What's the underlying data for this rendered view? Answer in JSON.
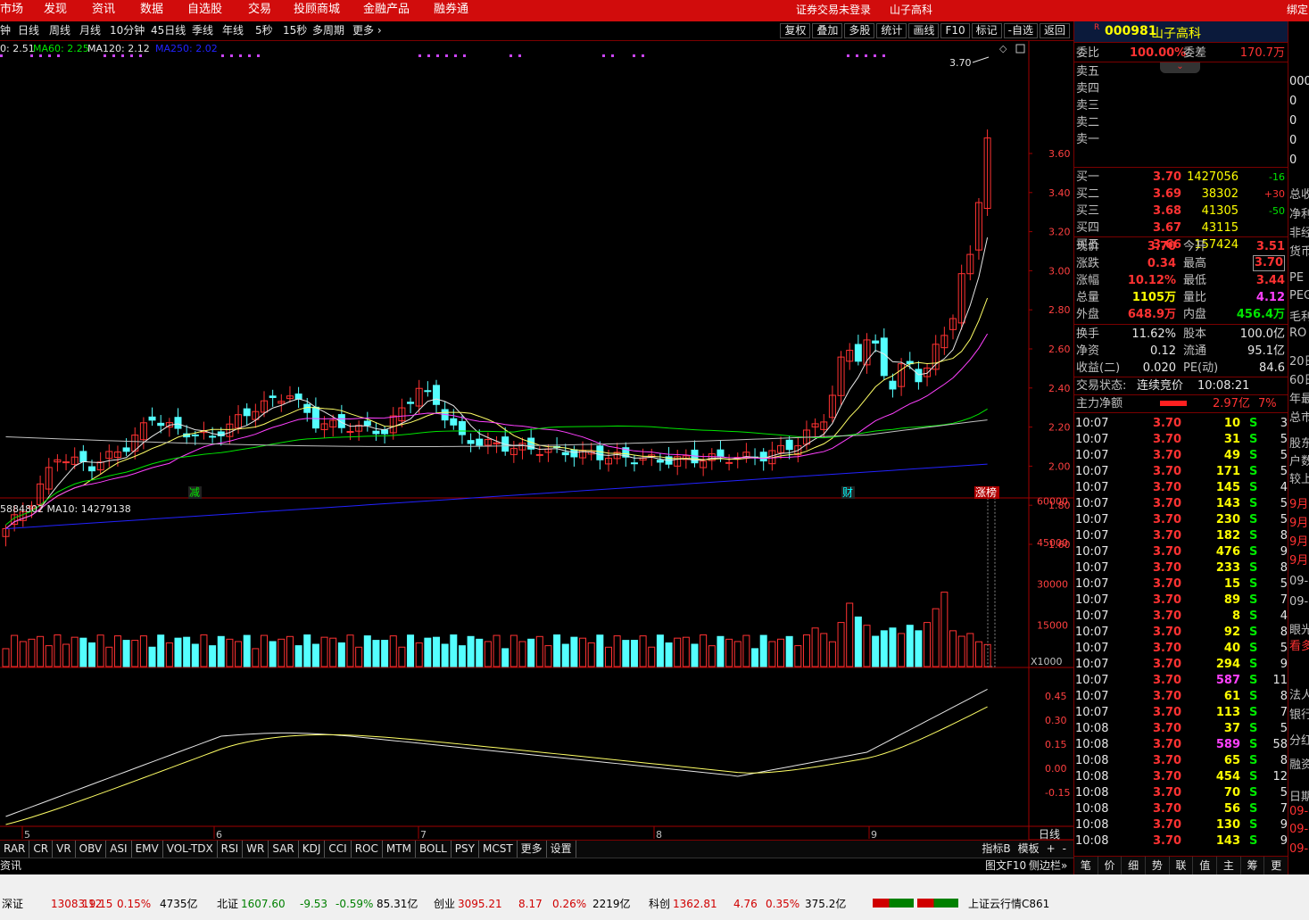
{
  "menu": {
    "items": [
      "市场",
      "发现",
      "资讯",
      "数据",
      "自选股",
      "交易",
      "投顾商城",
      "金融产品",
      "融券通"
    ],
    "right_items": [
      "证券交易未登录",
      "山子高科",
      "绑定"
    ]
  },
  "periods": {
    "items": [
      "钟",
      "日线",
      "周线",
      "月线",
      "10分钟",
      "45日线",
      "季线",
      "年线",
      "5秒",
      "15秒",
      "多周期",
      "更多"
    ],
    "tools": [
      "复权",
      "叠加",
      "多股",
      "统计",
      "画线",
      "F10",
      "标记",
      "-自选",
      "返回"
    ]
  },
  "chart": {
    "ma_legend": [
      {
        "text": "0: 2.51",
        "color": "#e6e6e6"
      },
      {
        "text": "MA60: 2.25",
        "color": "#00e600"
      },
      {
        "text": "MA120: 2.12",
        "color": "#e6e6e6"
      },
      {
        "text": "MA250: 2.02",
        "color": "#2222ff"
      }
    ],
    "price_ticks": [
      "3.60",
      "3.40",
      "3.20",
      "3.00",
      "2.80",
      "2.60",
      "2.40",
      "2.20",
      "2.00",
      "1.80",
      "1.60"
    ],
    "high_label": "3.70",
    "markers": [
      {
        "text": "减",
        "color": "#00e600"
      },
      {
        "text": "财",
        "color": "#00ffff"
      },
      {
        "text": "涨榜",
        "color": "#ffffff"
      }
    ],
    "vol_legend": "5884802 MA10: 14279138",
    "vol_ticks": [
      "60000",
      "45000",
      "30000",
      "15000"
    ],
    "vol_unit": "X1000",
    "macd_ticks": [
      "0.45",
      "0.30",
      "0.15",
      "0.00",
      "-0.15"
    ],
    "month_labels": [
      "5",
      "6",
      "7",
      "8",
      "9"
    ],
    "period_label": "日线"
  },
  "indicators": {
    "tabs": [
      "RAR",
      "CR",
      "VR",
      "OBV",
      "ASI",
      "EMV",
      "VOL-TDX",
      "RSI",
      "WR",
      "SAR",
      "KDJ",
      "CCI",
      "ROC",
      "MTM",
      "BOLL",
      "PSY",
      "MCST",
      "更多",
      "设置"
    ],
    "right": [
      "指标B",
      "模板",
      "+",
      "-"
    ]
  },
  "news": {
    "left": "资讯",
    "right": [
      "图文F10",
      "侧边栏»"
    ]
  },
  "stock": {
    "code": "000981",
    "name": "山子高科",
    "r_mark": "R"
  },
  "quote": {
    "weibi_label": "委比",
    "weibi": "100.00%",
    "weicha_label": "委差",
    "weicha": "170.7万",
    "sells": [
      "卖五",
      "卖四",
      "卖三",
      "卖二",
      "卖一"
    ],
    "buys": [
      {
        "label": "买一",
        "price": "3.70",
        "vol": "1427056",
        "chg": "-16"
      },
      {
        "label": "买二",
        "price": "3.69",
        "vol": "38302",
        "chg": "+30"
      },
      {
        "label": "买三",
        "price": "3.68",
        "vol": "41305",
        "chg": "-50"
      },
      {
        "label": "买四",
        "price": "3.67",
        "vol": "43115",
        "chg": ""
      },
      {
        "label": "买五",
        "price": "3.66",
        "vol": "157424",
        "chg": ""
      }
    ],
    "stats": [
      {
        "l1": "现价",
        "v1": "3.70",
        "c1": "red",
        "l2": "今开",
        "v2": "3.51",
        "c2": "red"
      },
      {
        "l1": "涨跌",
        "v1": "0.34",
        "c1": "red",
        "l2": "最高",
        "v2": "3.70",
        "c2": "red"
      },
      {
        "l1": "涨幅",
        "v1": "10.12%",
        "c1": "red",
        "l2": "最低",
        "v2": "3.44",
        "c2": "red"
      },
      {
        "l1": "总量",
        "v1": "1105万",
        "c1": "yel",
        "l2": "量比",
        "v2": "4.12",
        "c2": "mag"
      },
      {
        "l1": "外盘",
        "v1": "648.9万",
        "c1": "red",
        "l2": "内盘",
        "v2": "456.4万",
        "c2": "grn"
      }
    ],
    "stats2": [
      {
        "l1": "换手",
        "v1": "11.62%",
        "l2": "股本",
        "v2": "100.0亿"
      },
      {
        "l1": "净资",
        "v1": "0.12",
        "l2": "流通",
        "v2": "95.1亿"
      },
      {
        "l1": "收益(二)",
        "v1": "0.020",
        "l2": "PE(动)",
        "v2": "84.6"
      }
    ],
    "trade_status_label": "交易状态:",
    "trade_status": "连续竞价",
    "trade_time": "10:08:21",
    "main_net_label": "主力净额",
    "main_net": "2.97亿",
    "main_pct": "7%"
  },
  "ticks": [
    {
      "t": "10:07",
      "p": "3.70",
      "v": "10",
      "s": "S",
      "n": "3"
    },
    {
      "t": "10:07",
      "p": "3.70",
      "v": "31",
      "s": "S",
      "n": "5"
    },
    {
      "t": "10:07",
      "p": "3.70",
      "v": "49",
      "s": "S",
      "n": "5"
    },
    {
      "t": "10:07",
      "p": "3.70",
      "v": "171",
      "s": "S",
      "n": "5"
    },
    {
      "t": "10:07",
      "p": "3.70",
      "v": "145",
      "s": "S",
      "n": "4"
    },
    {
      "t": "10:07",
      "p": "3.70",
      "v": "143",
      "s": "S",
      "n": "5"
    },
    {
      "t": "10:07",
      "p": "3.70",
      "v": "230",
      "s": "S",
      "n": "5"
    },
    {
      "t": "10:07",
      "p": "3.70",
      "v": "182",
      "s": "S",
      "n": "8"
    },
    {
      "t": "10:07",
      "p": "3.70",
      "v": "476",
      "s": "S",
      "n": "9"
    },
    {
      "t": "10:07",
      "p": "3.70",
      "v": "233",
      "s": "S",
      "n": "8"
    },
    {
      "t": "10:07",
      "p": "3.70",
      "v": "15",
      "s": "S",
      "n": "5"
    },
    {
      "t": "10:07",
      "p": "3.70",
      "v": "89",
      "s": "S",
      "n": "7"
    },
    {
      "t": "10:07",
      "p": "3.70",
      "v": "8",
      "s": "S",
      "n": "4"
    },
    {
      "t": "10:07",
      "p": "3.70",
      "v": "92",
      "s": "S",
      "n": "8"
    },
    {
      "t": "10:07",
      "p": "3.70",
      "v": "40",
      "s": "S",
      "n": "5"
    },
    {
      "t": "10:07",
      "p": "3.70",
      "v": "294",
      "s": "S",
      "n": "9"
    },
    {
      "t": "10:07",
      "p": "3.70",
      "v": "587",
      "s": "S",
      "n": "11"
    },
    {
      "t": "10:07",
      "p": "3.70",
      "v": "61",
      "s": "S",
      "n": "8"
    },
    {
      "t": "10:07",
      "p": "3.70",
      "v": "113",
      "s": "S",
      "n": "7"
    },
    {
      "t": "10:08",
      "p": "3.70",
      "v": "37",
      "s": "S",
      "n": "5"
    },
    {
      "t": "10:08",
      "p": "3.70",
      "v": "589",
      "s": "S",
      "n": "58"
    },
    {
      "t": "10:08",
      "p": "3.70",
      "v": "65",
      "s": "S",
      "n": "8"
    },
    {
      "t": "10:08",
      "p": "3.70",
      "v": "454",
      "s": "S",
      "n": "12"
    },
    {
      "t": "10:08",
      "p": "3.70",
      "v": "70",
      "s": "S",
      "n": "5"
    },
    {
      "t": "10:08",
      "p": "3.70",
      "v": "56",
      "s": "S",
      "n": "7"
    },
    {
      "t": "10:08",
      "p": "3.70",
      "v": "130",
      "s": "S",
      "n": "9"
    },
    {
      "t": "10:08",
      "p": "3.70",
      "v": "143",
      "s": "S",
      "n": "9"
    }
  ],
  "right_tabs": [
    "笔",
    "价",
    "细",
    "势",
    "联",
    "值",
    "主",
    "筹",
    "更"
  ],
  "sliver": {
    "top": [
      "000",
      "0",
      "0",
      "0",
      "0"
    ],
    "items": [
      "总收",
      "净利",
      "非经",
      "货币",
      "PE",
      "PEG",
      "毛利",
      "RO",
      "20日",
      "60日",
      "年最",
      "总市",
      "股东",
      "户数",
      "较上",
      "9月",
      "9月",
      "9月",
      "9月",
      "09-",
      "09-",
      "眼光",
      "看多",
      "法人",
      "银行",
      "分红",
      "融资",
      "日期",
      "09-",
      "09-",
      "09-"
    ]
  },
  "status": {
    "indices": [
      {
        "name": "深证",
        "value": "13083.12",
        "chg": "19.15",
        "pct": "0.15%",
        "amt": "4735亿",
        "color": "red"
      },
      {
        "name": "北证",
        "value": "1607.60",
        "chg": "-9.53",
        "pct": "-0.59%",
        "amt": "85.31亿",
        "color": "grn"
      },
      {
        "name": "创业",
        "value": "3095.21",
        "chg": "8.17",
        "pct": "0.26%",
        "amt": "2219亿",
        "color": "red"
      },
      {
        "name": "科创",
        "value": "1362.81",
        "chg": "4.76",
        "pct": "0.35%",
        "amt": "375.2亿",
        "color": "red"
      }
    ],
    "cloud": "上证云行情C861"
  }
}
